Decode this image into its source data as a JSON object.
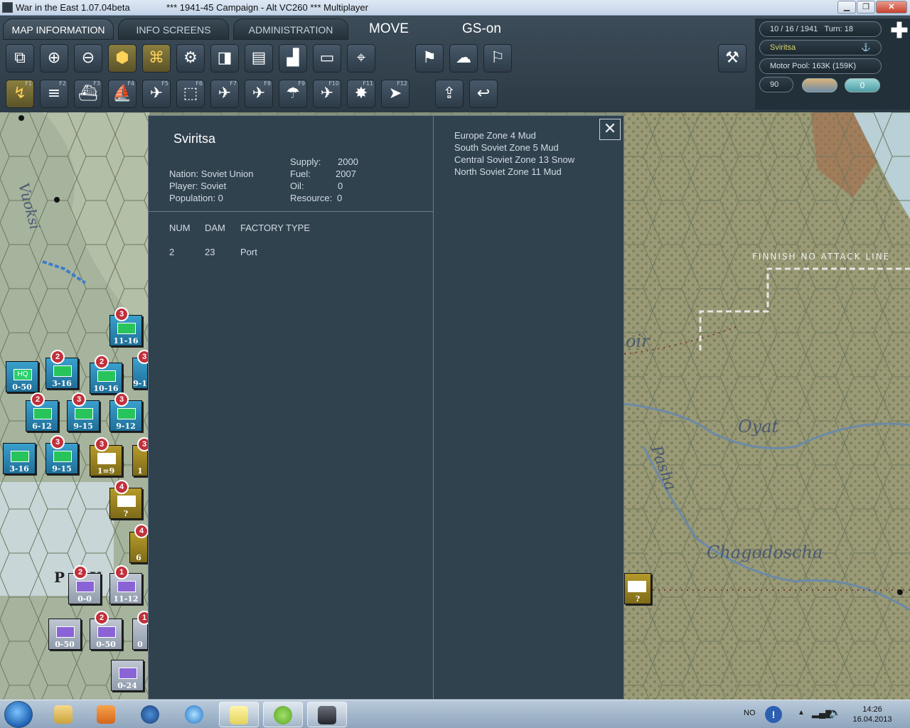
{
  "window": {
    "title": "War in the East 1.07.04beta",
    "campaign": "***   1941-45 Campaign - Alt VC260   ***   Multiplayer"
  },
  "tabs": [
    {
      "label": "MAP INFORMATION",
      "active": true
    },
    {
      "label": "INFO SCREENS",
      "active": false
    },
    {
      "label": "ADMINISTRATION",
      "active": false
    }
  ],
  "mode": {
    "move": "MOVE",
    "gs": "GS-on"
  },
  "toolbar_top": [
    {
      "icon": "overlay-icon"
    },
    {
      "icon": "zoom-in-icon"
    },
    {
      "icon": "zoom-out-icon"
    },
    {
      "icon": "hex-icon"
    },
    {
      "icon": "hex-select-icon"
    },
    {
      "icon": "gear-icon"
    },
    {
      "icon": "units-icon"
    },
    {
      "icon": "map-icon"
    },
    {
      "icon": "factory-icon"
    },
    {
      "icon": "frame-icon"
    },
    {
      "icon": "target-icon"
    },
    {
      "icon": "flag-exit-icon"
    },
    {
      "icon": "weather-icon"
    },
    {
      "icon": "flag-icon"
    },
    {
      "icon": "axe-flag-icon"
    }
  ],
  "toolbar_bottom": [
    {
      "icon": "move-icon",
      "key": "F1"
    },
    {
      "icon": "rail-icon",
      "key": "F2"
    },
    {
      "icon": "ship-icon",
      "key": "F3"
    },
    {
      "icon": "naval-icon",
      "key": "F4"
    },
    {
      "icon": "air-transfer-icon",
      "key": "F5"
    },
    {
      "icon": "air-supply-icon",
      "key": "F6"
    },
    {
      "icon": "bomber-icon",
      "key": "F7"
    },
    {
      "icon": "ground-attack-icon",
      "key": "F8"
    },
    {
      "icon": "paradrop-icon",
      "key": "F9"
    },
    {
      "icon": "interdiction-icon",
      "key": "F10"
    },
    {
      "icon": "explosion-icon",
      "key": "F11"
    },
    {
      "icon": "recon-icon",
      "key": "F12"
    },
    {
      "icon": "upload-icon"
    },
    {
      "icon": "undo-icon"
    }
  ],
  "status": {
    "date": "10 / 16 / 1941",
    "turn": "Turn: 18",
    "location": "Sviritsa",
    "motor_pool": "Motor Pool:  163K (159K)",
    "value": "90",
    "counter": "0"
  },
  "panel": {
    "title": "Sviritsa",
    "nation": "Nation: Soviet Union",
    "player": "Player: Soviet",
    "population": "Population: 0",
    "supply_label": "Supply:",
    "supply": "2000",
    "fuel_label": "Fuel:",
    "fuel": "2007",
    "oil_label": "Oil:",
    "oil": "0",
    "resource_label": "Resource:",
    "resource": "0",
    "headers": {
      "num": "NUM",
      "dam": "DAM",
      "type": "FACTORY TYPE"
    },
    "rows": [
      {
        "num": "2",
        "dam": "23",
        "type": "Port"
      }
    ],
    "zones": [
      "Europe Zone 4 Mud",
      "South Soviet Zone 5 Mud",
      "Central Soviet Zone 13 Snow",
      "North Soviet Zone 11 Mud"
    ]
  },
  "map": {
    "labels": {
      "vuoksi": "Vuoksi",
      "finnish_line": "FINNISH NO ATTACK LINE",
      "oir": "oir",
      "oyat": "Oyat",
      "pasha": "Pasha",
      "chagodoscha": "Chagodoscha",
      "town": "P     K"
    },
    "counters": [
      {
        "side": "sov",
        "badge": "3",
        "value": "11-16",
        "hq": false
      },
      {
        "side": "sov",
        "badge": "",
        "value": "0-50",
        "hq": true,
        "hq_label": "HQ"
      },
      {
        "side": "sov",
        "badge": "2",
        "value": "3-16"
      },
      {
        "side": "sov",
        "badge": "2",
        "value": "10-16"
      },
      {
        "side": "sov",
        "badge": "3",
        "value": "9-1"
      },
      {
        "side": "sov",
        "badge": "2",
        "value": "6-12"
      },
      {
        "side": "sov",
        "badge": "3",
        "value": "9-15"
      },
      {
        "side": "sov",
        "badge": "3",
        "value": "9-12"
      },
      {
        "side": "sov",
        "badge": "",
        "value": "3-16"
      },
      {
        "side": "sov",
        "badge": "3",
        "value": "9-15"
      },
      {
        "side": "fin",
        "badge": "3",
        "value": "1=9"
      },
      {
        "side": "fin",
        "badge": "3",
        "value": "1"
      },
      {
        "side": "fin",
        "badge": "4",
        "value": "?"
      },
      {
        "side": "fin",
        "badge": "4",
        "value": "6"
      },
      {
        "side": "axs",
        "badge": "2",
        "value": "0-0"
      },
      {
        "side": "axs",
        "badge": "1",
        "value": "11-12"
      },
      {
        "side": "axs",
        "badge": "",
        "value": "0-50"
      },
      {
        "side": "axs",
        "badge": "2",
        "value": "0-50"
      },
      {
        "side": "axs",
        "badge": "1",
        "value": "0"
      },
      {
        "side": "axs",
        "badge": "",
        "value": "0-24"
      },
      {
        "side": "fin",
        "badge": "",
        "value": "?"
      }
    ]
  },
  "taskbar": {
    "apps": [
      {
        "name": "explorer-icon",
        "open": false
      },
      {
        "name": "media-player-icon",
        "open": false
      },
      {
        "name": "hp-icon",
        "open": false
      },
      {
        "name": "ie-icon",
        "open": false
      },
      {
        "name": "notes-icon",
        "open": true
      },
      {
        "name": "spotify-icon",
        "open": true
      },
      {
        "name": "game-icon",
        "open": true
      }
    ],
    "lang": "NO",
    "time": "14:26",
    "date": "16.04.2013"
  }
}
